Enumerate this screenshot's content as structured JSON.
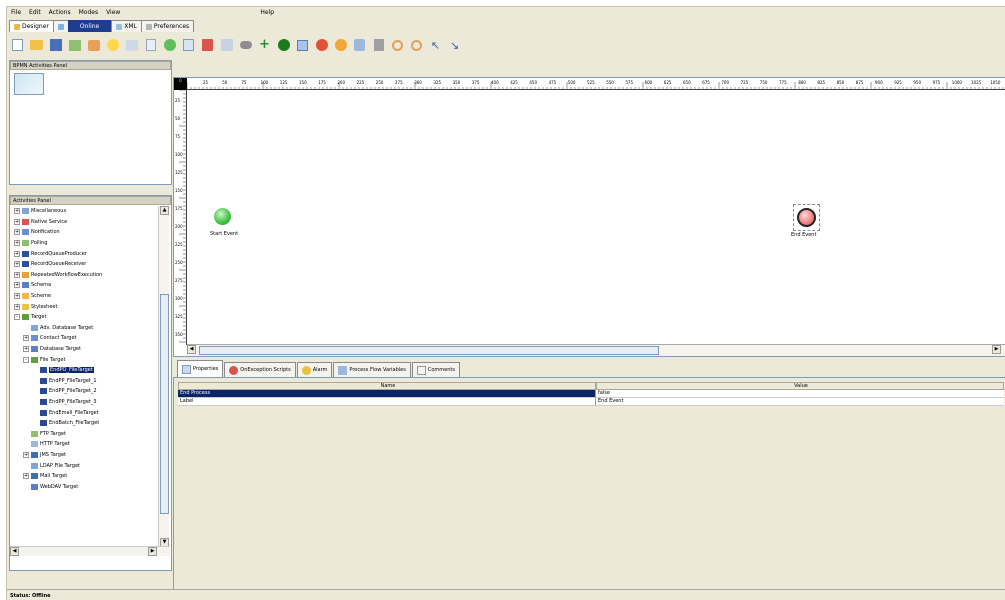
{
  "menubar": {
    "items": [
      "File",
      "Edit",
      "Actions",
      "Modes",
      "View",
      "Help"
    ]
  },
  "tabs": {
    "designer": "Designer",
    "online": "Online",
    "xml": "XML",
    "preferences": "Preferences"
  },
  "bpmn_panel": {
    "title": "BPMN Activities Panel"
  },
  "activities_panel": {
    "title": "Activities Panel",
    "items": [
      "Miscellaneous",
      "Native Service",
      "Notification",
      "Polling",
      "RecordQueueProducer",
      "RecordQueueReceiver",
      "RepeatedWorkflowExecution",
      "Schema",
      "Scheme",
      "Stylesheet",
      "Target",
      "Adv. Database Target",
      "Contact Target",
      "Database Target",
      "File Target",
      "EndPO_FileTarget",
      "EndPP_FileTarget_1",
      "EndPP_FileTarget_2",
      "EndPP_FileTarget_3",
      "EndEmail_FileTarget",
      "EndBatch_FileTarget",
      "FTP Target",
      "HTTP Target",
      "JMS Target",
      "LDAP File Target",
      "Mail Target",
      "WebDAV Target"
    ]
  },
  "ruler": {
    "corner": "0",
    "top_ticks": [
      "25",
      "50",
      "75",
      "100",
      "125",
      "150",
      "175",
      "200",
      "225",
      "250",
      "275",
      "300",
      "325",
      "350",
      "375",
      "400",
      "425",
      "450",
      "475",
      "500",
      "525",
      "550",
      "575",
      "600",
      "625",
      "650",
      "675",
      "700",
      "725",
      "750",
      "775",
      "800",
      "825",
      "850",
      "875",
      "900",
      "925",
      "950",
      "975",
      "1000",
      "1025",
      "1050"
    ],
    "left_ticks": [
      "25",
      "50",
      "75",
      "100",
      "125",
      "150",
      "175",
      "200",
      "225",
      "250",
      "275",
      "300",
      "325",
      "350"
    ]
  },
  "canvas": {
    "start_label": "Start Event",
    "end_label": "End Event"
  },
  "properties": {
    "tabs": [
      "Properties",
      "OnException Scripts",
      "Alarm",
      "Process Flow Variables",
      "Comments"
    ],
    "col_name": "Name",
    "col_value": "Value",
    "rows": [
      {
        "name": "End Process",
        "value": "false"
      },
      {
        "name": "Label",
        "value": "End Event"
      }
    ]
  },
  "status": {
    "text": "Status: Offline"
  },
  "colors": {
    "selection": "#0a246a",
    "start_event": "#3fbf3f",
    "end_event": "#f07a7a",
    "chrome": "#ece9d8"
  }
}
